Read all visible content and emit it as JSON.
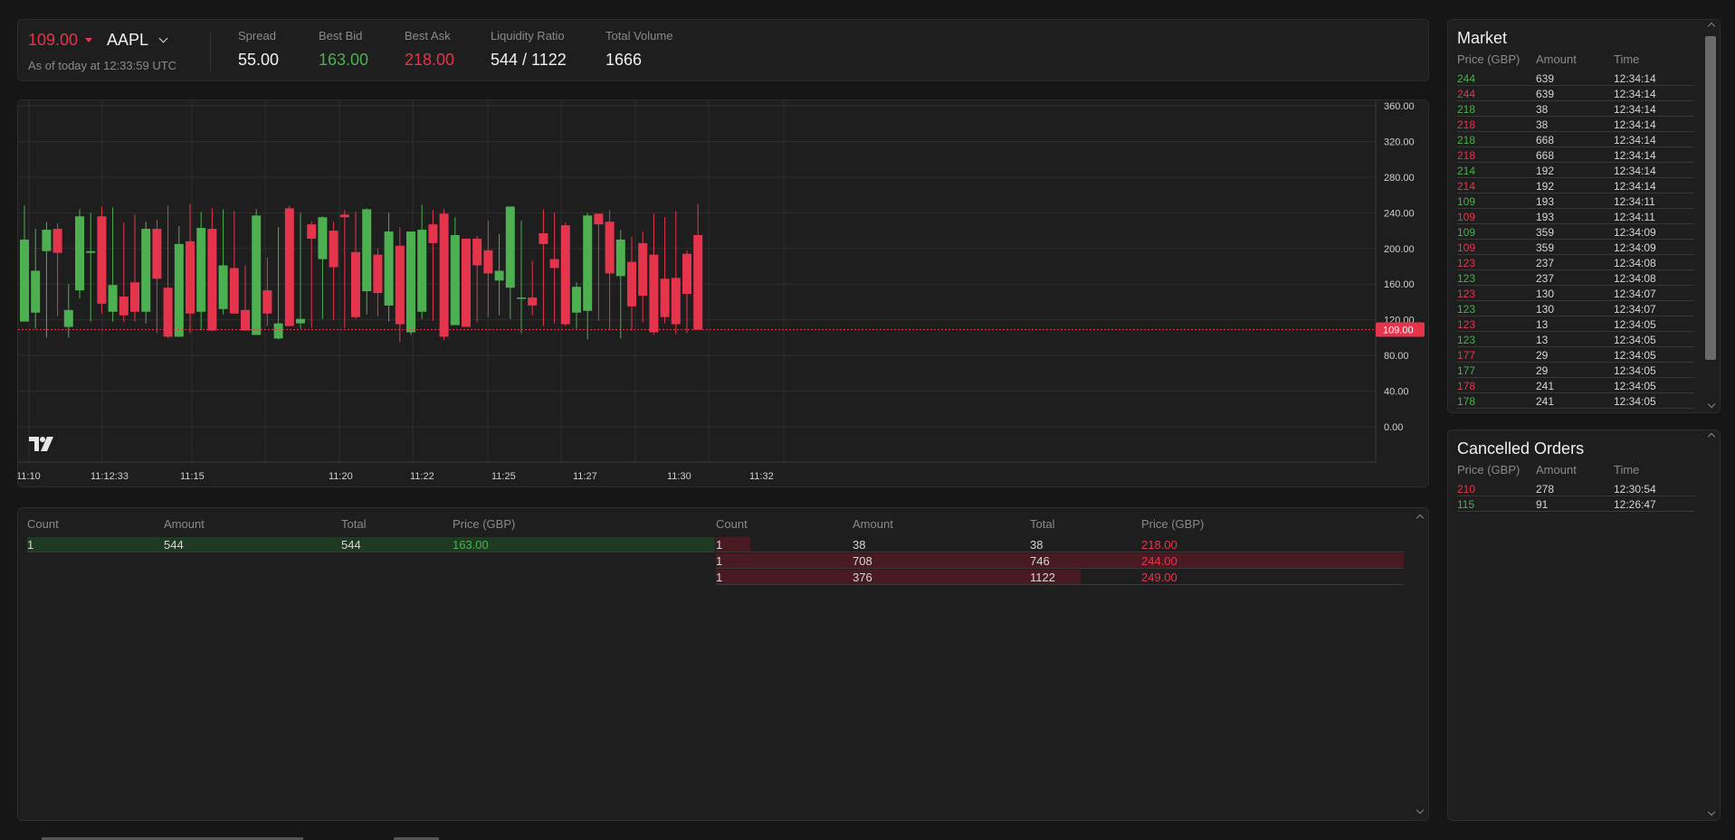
{
  "header": {
    "price": "109.00",
    "symbol": "AAPL",
    "as_of": "As of today at 12:33:59 UTC",
    "stats": [
      {
        "label": "Spread",
        "value": "55.00",
        "color": "#f0f0f0"
      },
      {
        "label": "Best Bid",
        "value": "163.00",
        "color": "#4caf50"
      },
      {
        "label": "Best Ask",
        "value": "218.00",
        "color": "#e5354d"
      },
      {
        "label": "Liquidity Ratio",
        "value": "544 / 1122",
        "color": "#f0f0f0"
      },
      {
        "label": "Total Volume",
        "value": "1666",
        "color": "#f0f0f0"
      }
    ]
  },
  "colors": {
    "up": "#4caf50",
    "down": "#e5354d",
    "bg": "#1e1e1e"
  },
  "chart_data": {
    "type": "candlestick",
    "y_ticks": [
      "360.00",
      "320.00",
      "280.00",
      "240.00",
      "200.00",
      "160.00",
      "120.00",
      "80.00",
      "40.00",
      "0.00"
    ],
    "ylim": [
      0,
      360
    ],
    "x_ticks": [
      "11:10",
      "11:12:33",
      "11:15",
      "11:20",
      "11:22",
      "11:25",
      "11:27",
      "11:30",
      "11:32"
    ],
    "last_price": 109,
    "last_price_label": "109.00",
    "candles": [
      {
        "o": 118,
        "c": 210,
        "h": 248,
        "l": 118
      },
      {
        "o": 128,
        "c": 175,
        "h": 222,
        "l": 110
      },
      {
        "o": 197,
        "c": 221,
        "h": 230,
        "l": 100
      },
      {
        "o": 222,
        "c": 195,
        "h": 228,
        "l": 124
      },
      {
        "o": 112,
        "c": 131,
        "h": 160,
        "l": 100
      },
      {
        "o": 153,
        "c": 236,
        "h": 244,
        "l": 144
      },
      {
        "o": 195,
        "c": 197,
        "h": 240,
        "l": 118
      },
      {
        "o": 236,
        "c": 138,
        "h": 247,
        "l": 127
      },
      {
        "o": 129,
        "c": 159,
        "h": 246,
        "l": 118
      },
      {
        "o": 146,
        "c": 125,
        "h": 229,
        "l": 117
      },
      {
        "o": 162,
        "c": 129,
        "h": 238,
        "l": 118
      },
      {
        "o": 129,
        "c": 222,
        "h": 230,
        "l": 116
      },
      {
        "o": 222,
        "c": 166,
        "h": 232,
        "l": 105
      },
      {
        "o": 156,
        "c": 101,
        "h": 248,
        "l": 99
      },
      {
        "o": 101,
        "c": 205,
        "h": 225,
        "l": 101
      },
      {
        "o": 208,
        "c": 127,
        "h": 250,
        "l": 105
      },
      {
        "o": 129,
        "c": 223,
        "h": 241,
        "l": 108
      },
      {
        "o": 222,
        "c": 108,
        "h": 245,
        "l": 107
      },
      {
        "o": 132,
        "c": 181,
        "h": 244,
        "l": 126
      },
      {
        "o": 178,
        "c": 127,
        "h": 242,
        "l": 127
      },
      {
        "o": 131,
        "c": 108,
        "h": 181,
        "l": 108
      },
      {
        "o": 103,
        "c": 237,
        "h": 244,
        "l": 103
      },
      {
        "o": 153,
        "c": 127,
        "h": 190,
        "l": 113
      },
      {
        "o": 99,
        "c": 116,
        "h": 224,
        "l": 98
      },
      {
        "o": 245,
        "c": 113,
        "h": 248,
        "l": 113
      },
      {
        "o": 116,
        "c": 121,
        "h": 240,
        "l": 110
      },
      {
        "o": 227,
        "c": 211,
        "h": 230,
        "l": 111
      },
      {
        "o": 188,
        "c": 235,
        "h": 236,
        "l": 121
      },
      {
        "o": 220,
        "c": 179,
        "h": 230,
        "l": 120
      },
      {
        "o": 238,
        "c": 235,
        "h": 243,
        "l": 111
      },
      {
        "o": 196,
        "c": 123,
        "h": 241,
        "l": 121
      },
      {
        "o": 152,
        "c": 244,
        "h": 245,
        "l": 126
      },
      {
        "o": 193,
        "c": 150,
        "h": 200,
        "l": 124
      },
      {
        "o": 136,
        "c": 219,
        "h": 240,
        "l": 118
      },
      {
        "o": 203,
        "c": 115,
        "h": 224,
        "l": 95
      },
      {
        "o": 106,
        "c": 219,
        "h": 219,
        "l": 103
      },
      {
        "o": 129,
        "c": 221,
        "h": 249,
        "l": 121
      },
      {
        "o": 227,
        "c": 206,
        "h": 243,
        "l": 119
      },
      {
        "o": 239,
        "c": 101,
        "h": 244,
        "l": 97
      },
      {
        "o": 114,
        "c": 215,
        "h": 235,
        "l": 115
      },
      {
        "o": 211,
        "c": 112,
        "h": 211,
        "l": 117
      },
      {
        "o": 211,
        "c": 181,
        "h": 214,
        "l": 117
      },
      {
        "o": 198,
        "c": 172,
        "h": 231,
        "l": 123
      },
      {
        "o": 164,
        "c": 175,
        "h": 216,
        "l": 125
      },
      {
        "o": 156,
        "c": 247,
        "h": 247,
        "l": 121
      },
      {
        "o": 145,
        "c": 145,
        "h": 231,
        "l": 105
      },
      {
        "o": 145,
        "c": 136,
        "h": 186,
        "l": 125
      },
      {
        "o": 217,
        "c": 205,
        "h": 244,
        "l": 113
      },
      {
        "o": 188,
        "c": 178,
        "h": 240,
        "l": 116
      },
      {
        "o": 226,
        "c": 115,
        "h": 229,
        "l": 113
      },
      {
        "o": 128,
        "c": 157,
        "h": 162,
        "l": 110
      },
      {
        "o": 130,
        "c": 237,
        "h": 240,
        "l": 98
      },
      {
        "o": 239,
        "c": 227,
        "h": 239,
        "l": 119
      },
      {
        "o": 230,
        "c": 172,
        "h": 243,
        "l": 108
      },
      {
        "o": 169,
        "c": 210,
        "h": 221,
        "l": 99
      },
      {
        "o": 185,
        "c": 135,
        "h": 213,
        "l": 108
      },
      {
        "o": 206,
        "c": 147,
        "h": 219,
        "l": 117
      },
      {
        "o": 193,
        "c": 106,
        "h": 239,
        "l": 103
      },
      {
        "o": 166,
        "c": 123,
        "h": 235,
        "l": 116
      },
      {
        "o": 167,
        "c": 115,
        "h": 242,
        "l": 104
      },
      {
        "o": 194,
        "c": 149,
        "h": 198,
        "l": 105
      },
      {
        "o": 215,
        "c": 109,
        "h": 250,
        "l": 109
      }
    ]
  },
  "orderbook": {
    "bid_headers": [
      "Count",
      "Amount",
      "Total",
      "Price (GBP)"
    ],
    "ask_headers": [
      "Count",
      "Amount",
      "Total",
      "Price (GBP)"
    ],
    "bids": [
      {
        "count": "1",
        "amount": "544",
        "total": "544",
        "price": "163.00",
        "depth": 1.0
      }
    ],
    "asks": [
      {
        "count": "1",
        "amount": "38",
        "total": "38",
        "price": "218.00",
        "depth": 0.05
      },
      {
        "count": "1",
        "amount": "708",
        "total": "746",
        "price": "244.00",
        "depth": 1.0
      },
      {
        "count": "1",
        "amount": "376",
        "total": "1122",
        "price": "249.00",
        "depth": 0.53
      }
    ]
  },
  "market": {
    "title": "Market",
    "headers": [
      "Price (GBP)",
      "Amount",
      "Time"
    ],
    "rows": [
      {
        "price": "244",
        "amount": "639",
        "time": "12:34:14",
        "side": "buy"
      },
      {
        "price": "244",
        "amount": "639",
        "time": "12:34:14",
        "side": "sell"
      },
      {
        "price": "218",
        "amount": "38",
        "time": "12:34:14",
        "side": "buy"
      },
      {
        "price": "218",
        "amount": "38",
        "time": "12:34:14",
        "side": "sell"
      },
      {
        "price": "218",
        "amount": "668",
        "time": "12:34:14",
        "side": "buy"
      },
      {
        "price": "218",
        "amount": "668",
        "time": "12:34:14",
        "side": "sell"
      },
      {
        "price": "214",
        "amount": "192",
        "time": "12:34:14",
        "side": "buy"
      },
      {
        "price": "214",
        "amount": "192",
        "time": "12:34:14",
        "side": "sell"
      },
      {
        "price": "109",
        "amount": "193",
        "time": "12:34:11",
        "side": "buy"
      },
      {
        "price": "109",
        "amount": "193",
        "time": "12:34:11",
        "side": "sell"
      },
      {
        "price": "109",
        "amount": "359",
        "time": "12:34:09",
        "side": "buy"
      },
      {
        "price": "109",
        "amount": "359",
        "time": "12:34:09",
        "side": "sell"
      },
      {
        "price": "123",
        "amount": "237",
        "time": "12:34:08",
        "side": "sell"
      },
      {
        "price": "123",
        "amount": "237",
        "time": "12:34:08",
        "side": "buy"
      },
      {
        "price": "123",
        "amount": "130",
        "time": "12:34:07",
        "side": "sell"
      },
      {
        "price": "123",
        "amount": "130",
        "time": "12:34:07",
        "side": "buy"
      },
      {
        "price": "123",
        "amount": "13",
        "time": "12:34:05",
        "side": "sell"
      },
      {
        "price": "123",
        "amount": "13",
        "time": "12:34:05",
        "side": "buy"
      },
      {
        "price": "177",
        "amount": "29",
        "time": "12:34:05",
        "side": "sell"
      },
      {
        "price": "177",
        "amount": "29",
        "time": "12:34:05",
        "side": "buy"
      },
      {
        "price": "178",
        "amount": "241",
        "time": "12:34:05",
        "side": "sell"
      },
      {
        "price": "178",
        "amount": "241",
        "time": "12:34:05",
        "side": "buy"
      }
    ]
  },
  "cancelled": {
    "title": "Cancelled Orders",
    "headers": [
      "Price (GBP)",
      "Amount",
      "Time"
    ],
    "rows": [
      {
        "price": "210",
        "amount": "278",
        "time": "12:30:54",
        "side": "sell"
      },
      {
        "price": "115",
        "amount": "91",
        "time": "12:26:47",
        "side": "buy"
      }
    ]
  }
}
